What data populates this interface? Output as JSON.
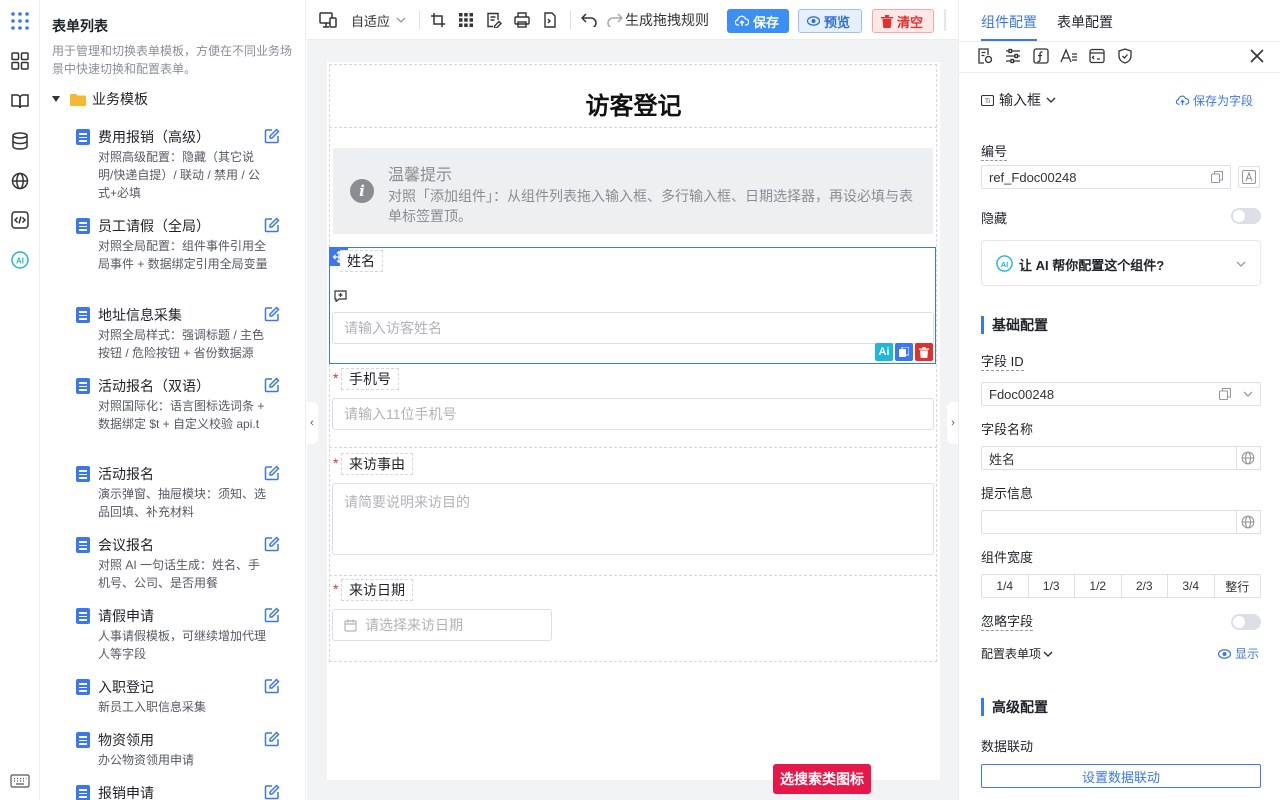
{
  "left_panel": {
    "title": "表单列表",
    "description": "用于管理和切换表单模板，方便在不同业务场景中快速切换和配置表单。",
    "folder": "业务模板",
    "templates": [
      {
        "name": "费用报销（高级）",
        "desc": "对照高级配置：隐藏（其它说明/快递自提）/ 联动 / 禁用 / 公式+必填"
      },
      {
        "name": "员工请假（全局）",
        "desc": "对照全局配置：组件事件引用全局事件 + 数据绑定引用全局变量"
      },
      {
        "name": "地址信息采集",
        "desc": "对照全局样式：强调标题 / 主色按钮 / 危险按钮 + 省份数据源"
      },
      {
        "name": "活动报名（双语）",
        "desc": "对照国际化：语言图标选词条 + 数据绑定 $t + 自定义校验 api.t"
      },
      {
        "name": "活动报名",
        "desc": "演示弹窗、抽屉模块：须知、选品回填、补充材料"
      },
      {
        "name": "会议报名",
        "desc": "对照 AI 一句话生成：姓名、手机号、公司、是否用餐"
      },
      {
        "name": "请假申请",
        "desc": "人事请假模板，可继续增加代理人等字段"
      },
      {
        "name": "入职登记",
        "desc": "新员工入职信息采集"
      },
      {
        "name": "物资领用",
        "desc": "办公物资领用申请"
      },
      {
        "name": "报销申请",
        "desc": ""
      }
    ]
  },
  "toolbar": {
    "layout": "自适应",
    "generate_rule": "生成拖拽规则",
    "save": "保存",
    "preview": "预览",
    "clear": "清空"
  },
  "form": {
    "title": "访客登记",
    "tip": {
      "title": "温馨提示",
      "text": "对照「添加组件」：从组件列表拖入输入框、多行输入框、日期选择器，再设必填与表单标签置顶。"
    },
    "fields": [
      {
        "label": "姓名",
        "placeholder": "请输入访客姓名",
        "required": false
      },
      {
        "label": "手机号",
        "placeholder": "请输入11位手机号",
        "required": true
      },
      {
        "label": "来访事由",
        "placeholder": "请简要说明来访目的",
        "required": true
      },
      {
        "label": "来访日期",
        "placeholder": "请选择来访日期",
        "required": true
      }
    ],
    "float_button": "选搜索类图标"
  },
  "right_panel": {
    "tab_component": "组件配置",
    "tab_form": "表单配置",
    "component_type": "输入框",
    "save_as_field": "保存为字段",
    "code_label": "编号",
    "code_value": "ref_Fdoc00248",
    "hidden_label": "隐藏",
    "ai_prompt": "让 AI 帮你配置这个组件?",
    "basic_section": "基础配置",
    "field_id_label": "字段 ID",
    "field_id_value": "Fdoc00248",
    "field_name_label": "字段名称",
    "field_name_value": "姓名",
    "hint_label": "提示信息",
    "width_label": "组件宽度",
    "widths": [
      "1/4",
      "1/3",
      "1/2",
      "2/3",
      "3/4",
      "整行"
    ],
    "ignore_label": "忽略字段",
    "form_item_label": "配置表单项",
    "show_label": "显示",
    "advanced_section": "高级配置",
    "linkage_label": "数据联动",
    "linkage_button": "设置数据联动"
  },
  "colors": {
    "primary": "#3b77f0",
    "danger": "#e03131",
    "float": "#e8174a"
  }
}
